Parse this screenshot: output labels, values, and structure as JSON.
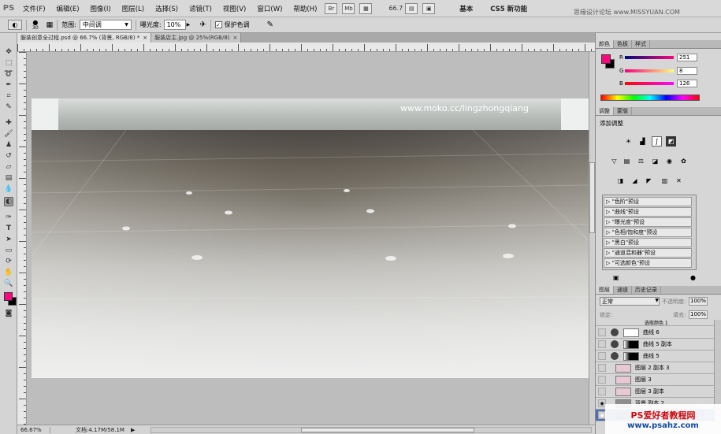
{
  "app": {
    "logo": "PS"
  },
  "menu": [
    "文件(F)",
    "编辑(E)",
    "图像(I)",
    "图层(L)",
    "选择(S)",
    "滤镜(T)",
    "视图(V)",
    "窗口(W)",
    "帮助(H)"
  ],
  "menubar": {
    "zoom": "66.7",
    "workspace": "基本",
    "workspace2": "CS5 新功能",
    "watermark_top": "思缘设计论坛 www.MISSYUAN.COM"
  },
  "options": {
    "brush_size": "30",
    "range_label": "范围:",
    "range_value": "中间调",
    "exposure_label": "曝光度:",
    "exposure_value": "10%",
    "protect_label": "保护色调",
    "protect_checked": true
  },
  "tabs": [
    {
      "label": "服装创意全过程.psd @ 66.7% (背景, RGB/8) *",
      "active": true
    },
    {
      "label": "服装店主.jpg @ 25%(RGB/8)",
      "active": false
    }
  ],
  "canvas": {
    "watermark": "www.moko.cc/lingzhongqiang"
  },
  "status": {
    "zoom": "66.67%",
    "doc": "文档:4.17M/58.1M"
  },
  "color_panel": {
    "tabs": [
      "颜色",
      "色板",
      "样式"
    ],
    "r_label": "R",
    "g_label": "G",
    "b_label": "B",
    "r": "251",
    "g": "8",
    "b": "126",
    "fg_color": "#fb087e"
  },
  "adjust_panel": {
    "tabs": [
      "调整",
      "蒙版"
    ],
    "title": "添加调整",
    "presets": [
      "\"色阶\"预设",
      "\"曲线\"预设",
      "\"曝光度\"预设",
      "\"色相/饱和度\"预设",
      "\"黑白\"预设",
      "\"通道混和器\"预设",
      "\"可选颜色\"预设"
    ]
  },
  "layers_panel": {
    "tabs": [
      "图层",
      "通道",
      "历史记录"
    ],
    "blend_mode": "正常",
    "opacity_label": "不透明度:",
    "opacity": "100%",
    "lock_label": "锁定:",
    "fill_label": "填充:",
    "fill": "100%",
    "layers": [
      {
        "name": "曲线 6"
      },
      {
        "name": "曲线 5 副本"
      },
      {
        "name": "曲线 5"
      },
      {
        "name": "图层 2 副本 3"
      },
      {
        "name": "图层 3"
      },
      {
        "name": "图层 3 副本"
      },
      {
        "name": "背景 副本 2"
      },
      {
        "name": "背景"
      }
    ],
    "partial_top": "选取颜色 1"
  },
  "bottom_watermark": {
    "line1": "PS爱好者教程网",
    "line2": "www.psahz.com"
  }
}
